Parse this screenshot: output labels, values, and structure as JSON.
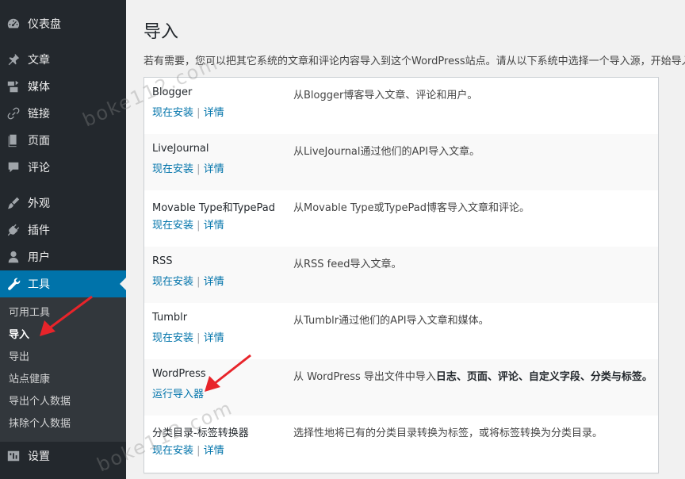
{
  "sidebar": {
    "items": [
      {
        "label": "仪表盘",
        "icon": "dashboard-icon"
      },
      {
        "label": "文章",
        "icon": "pin-icon"
      },
      {
        "label": "媒体",
        "icon": "media-icon"
      },
      {
        "label": "链接",
        "icon": "link-icon"
      },
      {
        "label": "页面",
        "icon": "page-icon"
      },
      {
        "label": "评论",
        "icon": "comment-icon"
      },
      {
        "label": "外观",
        "icon": "brush-icon"
      },
      {
        "label": "插件",
        "icon": "plugin-icon"
      },
      {
        "label": "用户",
        "icon": "user-icon"
      },
      {
        "label": "工具",
        "icon": "wrench-icon"
      },
      {
        "label": "设置",
        "icon": "settings-icon"
      }
    ],
    "submenu": [
      "可用工具",
      "导入",
      "导出",
      "站点健康",
      "导出个人数据",
      "抹除个人数据"
    ],
    "current_sub": "导入",
    "accent_color": "#0073aa"
  },
  "main": {
    "title": "导入",
    "intro": "若有需要，您可以把其它系统的文章和评论内容导入到这个WordPress站点。请从以下系统中选择一个导入源，开始导入"
  },
  "importers": [
    {
      "name": "Blogger",
      "install": "现在安装",
      "sep": "|",
      "details": "详情",
      "desc": "从Blogger博客导入文章、评论和用户。"
    },
    {
      "name": "LiveJournal",
      "install": "现在安装",
      "sep": "|",
      "details": "详情",
      "desc": "从LiveJournal通过他们的API导入文章。"
    },
    {
      "name": "Movable Type和TypePad",
      "install": "现在安装",
      "sep": "|",
      "details": "详情",
      "desc": "从Movable Type或TypePad博客导入文章和评论。"
    },
    {
      "name": "RSS",
      "install": "现在安装",
      "sep": "|",
      "details": "详情",
      "desc": "从RSS feed导入文章。"
    },
    {
      "name": "Tumblr",
      "install": "现在安装",
      "sep": "|",
      "details": "详情",
      "desc": "从Tumblr通过他们的API导入文章和媒体。"
    },
    {
      "name": "WordPress",
      "run": "运行导入器",
      "desc_prefix": "从 WordPress 导出文件中导入",
      "desc_bold": "日志、页面、评论、自定义字段、分类与标签。"
    },
    {
      "name": "分类目录-标签转换器",
      "install": "现在安装",
      "sep": "|",
      "details": "详情",
      "desc": "选择性地将已有的分类目录转换为标签，或将标签转换为分类目录。"
    }
  ],
  "watermarks": [
    "boke112.com",
    "boke112.com"
  ],
  "arrow_color": "#e8242a"
}
